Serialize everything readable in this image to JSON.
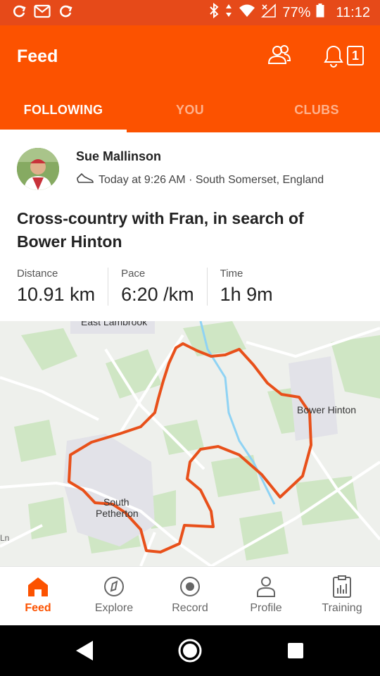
{
  "status_bar": {
    "left_icons": [
      "refresh-icon",
      "gmail-icon",
      "refresh-icon"
    ],
    "battery": "77%",
    "time": "11:12"
  },
  "app_bar": {
    "title": "Feed",
    "notification_count": "1"
  },
  "tabs": [
    {
      "label": "FOLLOWING",
      "active": true
    },
    {
      "label": "YOU",
      "active": false
    },
    {
      "label": "CLUBS",
      "active": false
    }
  ],
  "activity": {
    "athlete": "Sue Mallinson",
    "meta": "Today at 9:26 AM · South Somerset, England",
    "title": "Cross-country with Fran, in search of Bower Hinton",
    "stats": [
      {
        "label": "Distance",
        "value": "10.91 km"
      },
      {
        "label": "Pace",
        "value": "6:20 /km"
      },
      {
        "label": "Time",
        "value": "1h 9m"
      }
    ]
  },
  "map": {
    "labels": {
      "east_lambrook": "East Lambrook",
      "bower_hinton": "Bower Hinton",
      "south_petherton_1": "South",
      "south_petherton_2": "Petherton",
      "edge": "Ln"
    },
    "route_color": "#E8501A"
  },
  "bottom_nav": [
    {
      "label": "Feed",
      "icon": "home-icon",
      "active": true
    },
    {
      "label": "Explore",
      "icon": "compass-icon",
      "active": false
    },
    {
      "label": "Record",
      "icon": "record-icon",
      "active": false
    },
    {
      "label": "Profile",
      "icon": "person-icon",
      "active": false
    },
    {
      "label": "Training",
      "icon": "clipboard-chart-icon",
      "active": false
    }
  ],
  "colors": {
    "brand": "#FC5200",
    "status_bar": "#E64A19"
  }
}
